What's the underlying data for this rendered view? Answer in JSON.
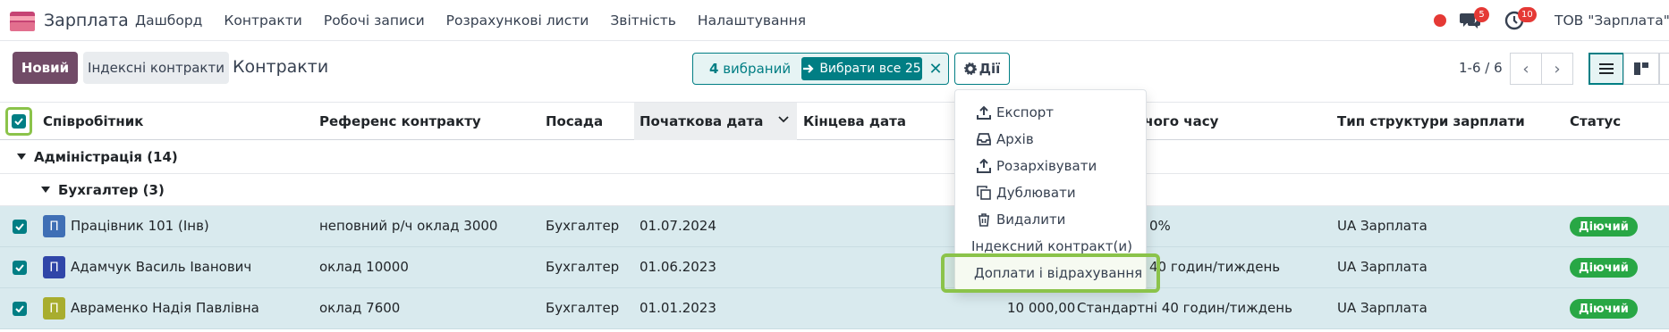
{
  "nav": {
    "app_name": "Зарплата",
    "menu": [
      "Дашборд",
      "Контракти",
      "Робочі записи",
      "Розрахункові листи",
      "Звітність",
      "Налаштування"
    ],
    "chat_count": "5",
    "activity_count": "10",
    "company": "ТОВ \"Зарплата\""
  },
  "toolbar": {
    "new_label": "Новий",
    "index_label": "Індексні контракти",
    "breadcrumb": "Контракти",
    "selected_count": "4",
    "selected_suffix": " вибраний",
    "select_all": "Вибрати все 25",
    "actions_label": "Дії",
    "pager": "1-6 / 6"
  },
  "columns": [
    "Співробітник",
    "Референс контракту",
    "Посада",
    "Початкова дата",
    "Кінцева дата",
    "очого часу",
    "Тип структури зарплати",
    "Статус"
  ],
  "groups": {
    "level1": "Адміністрація (14)",
    "level2": "Бухгалтер (3)"
  },
  "rows": [
    {
      "avatar": "П",
      "avatar_color": "#3f6fb5",
      "employee": "Працівник 101 (Інв)",
      "reference": "неповний р/ч оклад 3000",
      "position": "Бухгалтер",
      "start": "01.07.2024",
      "wage": "",
      "schedule": "0%",
      "structure": "UA Зарплата",
      "status": "Діючий"
    },
    {
      "avatar": "П",
      "avatar_color": "#3046a8",
      "employee": "Адамчук Василь Іванович",
      "reference": "оклад 10000",
      "position": "Бухгалтер",
      "start": "01.06.2023",
      "wage": "",
      "schedule": "40 годин/тиждень",
      "structure": "UA Зарплата",
      "status": "Діючий"
    },
    {
      "avatar": "П",
      "avatar_color": "#a8ad2e",
      "employee": "Авраменко Надія Павлівна",
      "reference": "оклад 7600",
      "position": "Бухгалтер",
      "start": "01.01.2023",
      "wage": "10 000,00",
      "schedule": "Стандартні 40 годин/тиждень",
      "structure": "UA Зарплата",
      "status": "Діючий"
    }
  ],
  "actions_menu": [
    "Експорт",
    "Архів",
    "Розархівувати",
    "Дублювати",
    "Видалити",
    "Індексний контракт(и)",
    "Доплати і відрахування"
  ],
  "colors": {
    "brand": "#714b67",
    "accent": "#017e84",
    "highlight": "#8bc34a",
    "status": "#28a745"
  }
}
